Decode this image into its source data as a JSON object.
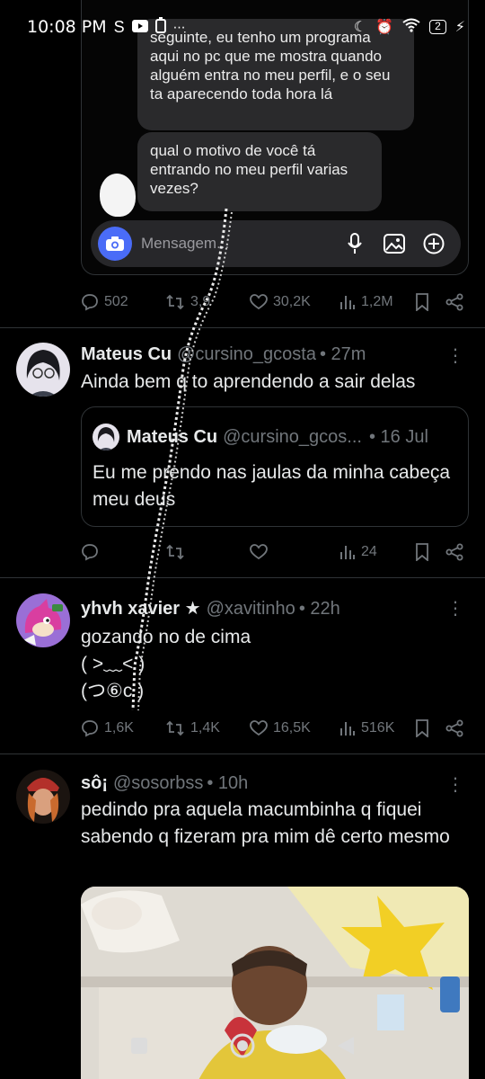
{
  "status_bar": {
    "time": "10:08 PM",
    "battery": "2"
  },
  "dm_card": {
    "bubble_one": "seguinte, eu tenho um programa aqui no pc que me mostra quando alguém entra no meu perfil, e o seu ta aparecendo toda hora lá",
    "bubble_two": "qual o motivo de você tá entrando no meu perfil varias vezes?",
    "composer_placeholder": "Mensagem..."
  },
  "tweet1_actions": {
    "replies": "502",
    "reposts": "3,9",
    "likes": "30,2K",
    "views": "1,2M"
  },
  "tweet2": {
    "name": "Mateus Cu",
    "handle": "@cursino_gcosta",
    "time": "• 27m",
    "text": "Ainda bem q to aprendendo a sair delas",
    "quote": {
      "name": "Mateus Cu",
      "handle": "@cursino_gcos...",
      "time": "• 16 Jul",
      "text": "Eu me prendo nas jaulas da minha cabeça meu deus"
    },
    "actions": {
      "replies": "",
      "reposts": "",
      "likes": "",
      "views": "24"
    }
  },
  "tweet3": {
    "name": "yhvh xavier ★",
    "handle": "@xavitinho",
    "time": "• 22h",
    "text_line1": "gozando no de cima",
    "text_line2": "( >﹏< )",
    "text_line3": "(つ⑥c )",
    "actions": {
      "replies": "1,6K",
      "reposts": "1,4K",
      "likes": "16,5K",
      "views": "516K"
    }
  },
  "tweet4": {
    "name": "sô¡",
    "handle": "@sosorbss",
    "time": "• 10h",
    "text": "pedindo pra aquela macumbinha q fiquei sabendo q fizeram pra mim dê certo mesmo"
  },
  "colors": {
    "background": "#000000",
    "muted": "#71767b",
    "divider": "#2f3336",
    "camera_button": "#4a6cf7"
  }
}
